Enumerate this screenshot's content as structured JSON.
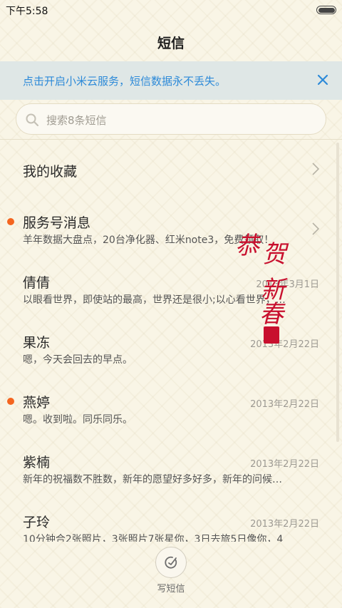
{
  "status_bar": {
    "time": "下午5:58"
  },
  "header": {
    "title": "短信"
  },
  "banner": {
    "text": "点击开启小米云服务，短信数据永不丢失。"
  },
  "search": {
    "placeholder": "搜索8条短信"
  },
  "conversations": [
    {
      "name": "我的收藏",
      "preview": "",
      "date": "",
      "unread": false,
      "chevron": true
    },
    {
      "name": "服务号消息",
      "preview": "羊年数据大盘点，20台净化器、红米note3，免费领取！",
      "date": "",
      "unread": true,
      "chevron": true
    },
    {
      "name": "倩倩",
      "preview": "以眼看世界，即使站的最高，世界还是很小;以心看世界，…",
      "date": "2013年3月1日",
      "unread": false,
      "chevron": false
    },
    {
      "name": "果冻",
      "preview": "嗯，今天会回去的早点。",
      "date": "2013年2月22日",
      "unread": false,
      "chevron": false
    },
    {
      "name": "燕婷",
      "preview": "嗯。收到啦。同乐同乐。",
      "date": "2013年2月22日",
      "unread": true,
      "chevron": false
    },
    {
      "name": "紫楠",
      "preview": "新年的祝福数不胜数，新年的愿望好多好多，新年的问候…",
      "date": "2013年2月22日",
      "unread": false,
      "chevron": false
    },
    {
      "name": "子玲",
      "preview": "10分钟合2张照片，3张照片7张星你，3日去旅5日像你，4",
      "date": "2013年2月22日",
      "unread": false,
      "chevron": false
    }
  ],
  "stamp": {
    "chars": [
      "恭",
      "贺",
      "新",
      "春"
    ]
  },
  "compose": {
    "label": "写短信"
  },
  "colors": {
    "accent": "#2d8ad8",
    "unread_dot": "#f4651f",
    "stamp_red": "#c8102e"
  }
}
